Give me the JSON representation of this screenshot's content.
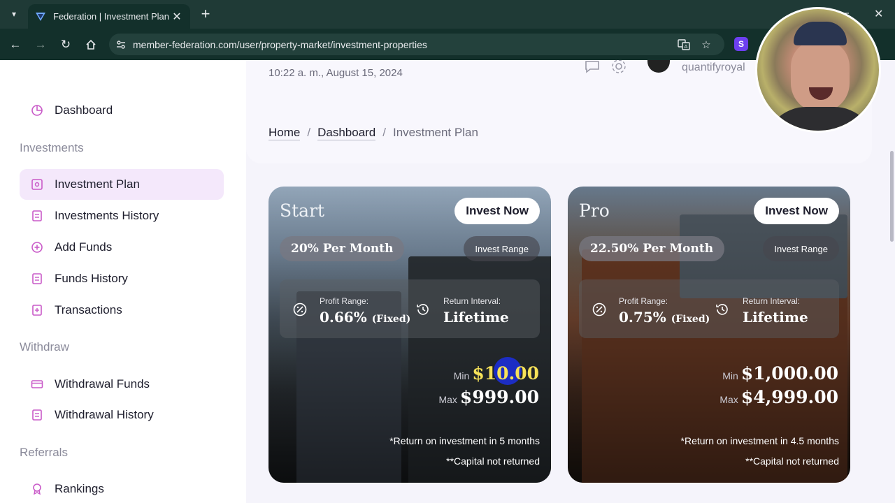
{
  "browser": {
    "tab_title": "Federation | Investment Plan",
    "url": "member-federation.com/user/property-market/investment-properties"
  },
  "header": {
    "datetime": "10:22 a. m., August 15, 2024",
    "username": "quantifyroyal"
  },
  "breadcrumb": {
    "home": "Home",
    "separator": "/",
    "dashboard": "Dashboard",
    "current": "Investment Plan"
  },
  "sidebar": {
    "dashboard": "Dashboard",
    "investments_section": "Investments",
    "investment_plan": "Investment Plan",
    "investments_history": "Investments History",
    "add_funds": "Add Funds",
    "funds_history": "Funds History",
    "transactions": "Transactions",
    "withdraw_section": "Withdraw",
    "withdrawal_funds": "Withdrawal Funds",
    "withdrawal_history": "Withdrawal History",
    "referrals_section": "Referrals",
    "rankings": "Rankings"
  },
  "plans": [
    {
      "name": "Start",
      "invest_button": "Invest Now",
      "rate": "20% Per Month",
      "range_label": "Invest Range",
      "profit_label": "Profit Range:",
      "profit_value": "0.66%",
      "profit_suffix": "(Fixed)",
      "interval_label": "Return Interval:",
      "interval_value": "Lifetime",
      "min_label": "Min",
      "min_value": "$10.00",
      "max_label": "Max",
      "max_value": "$999.00",
      "note_return": "*Return on investment in 5 months",
      "note_capital": "**Capital not returned"
    },
    {
      "name": "Pro",
      "invest_button": "Invest Now",
      "rate": "22.50% Per Month",
      "range_label": "Invest Range",
      "profit_label": "Profit Range:",
      "profit_value": "0.75%",
      "profit_suffix": "(Fixed)",
      "interval_label": "Return Interval:",
      "interval_value": "Lifetime",
      "min_label": "Min",
      "min_value": "$1,000.00",
      "max_label": "Max",
      "max_value": "$4,999.00",
      "note_return": "*Return on investment in 4.5 months",
      "note_capital": "**Capital not returned"
    }
  ],
  "colors": {
    "browser_frame": "#13302b",
    "sidebar_active": "#f4e8fb",
    "accent_icon": "#c95ac8",
    "page_bg": "#f5f4fb"
  }
}
